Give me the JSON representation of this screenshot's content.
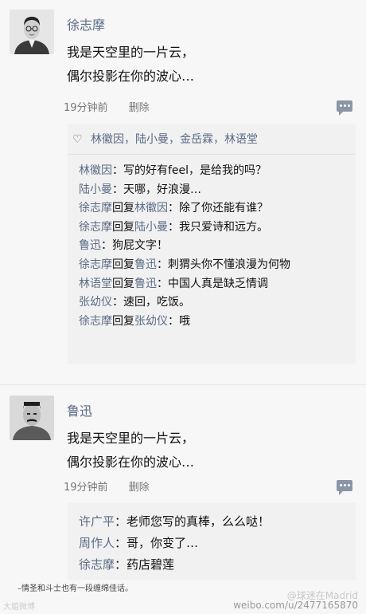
{
  "posts": [
    {
      "author": "徐志摩",
      "avatar_icon": "portrait-glasses",
      "body": [
        "我是天空里的一片云，",
        "偶尔投影在你的波心…"
      ],
      "time": "19分钟前",
      "delete_label": "删除",
      "likes": "林徽因，陆小曼，金岳霖，林语堂",
      "replies": [
        {
          "name": "林徽因",
          "text": "：写的好有feel，是给我的吗？"
        },
        {
          "name": "陆小曼",
          "text": "：天哪，好浪漫…"
        },
        {
          "name": "徐志摩",
          "mid": "回复",
          "target": "林徽因",
          "text": "：除了你还能有谁？"
        },
        {
          "name": "徐志摩",
          "mid": "回复",
          "target": "陆小曼",
          "text": "：我只爱诗和远方。"
        },
        {
          "name": "鲁迅",
          "text": "：狗屁文字！"
        },
        {
          "name": "徐志摩",
          "mid": "回复",
          "target": "鲁迅",
          "text": "：刺猬头你不懂浪漫为何物"
        },
        {
          "name": "林语堂",
          "mid": "回复",
          "target": "鲁迅",
          "text": "：中国人真是缺乏情调"
        },
        {
          "name": "张幼仪",
          "text": "：速回，吃饭。"
        },
        {
          "name": "徐志摩",
          "mid": "回复",
          "target": "张幼仪",
          "text": "：哦"
        }
      ]
    },
    {
      "author": "鲁迅",
      "avatar_icon": "portrait-mustache",
      "body": [
        "我是天空里的一片云，",
        "偶尔投影在你的波心…"
      ],
      "time": "19分钟前",
      "delete_label": "删除",
      "replies": [
        {
          "name": "许广平",
          "text": "：老师您写的真棒，么么哒！"
        },
        {
          "name": "周作人",
          "text": "：哥，你变了…"
        },
        {
          "name": "徐志摩",
          "text": "：药店碧莲"
        }
      ]
    }
  ],
  "footer": {
    "caption": "–情圣和斗士也有一段缠绵佳话。",
    "watermark_left": "大姐微博",
    "watermark_right": "@球迷在Madrid",
    "watermark_url": "weibo.com/u/2477165870"
  },
  "colors": {
    "name": "#5b6b86",
    "text": "#111111",
    "meta": "#777777",
    "panel": "#f1f1f1"
  }
}
